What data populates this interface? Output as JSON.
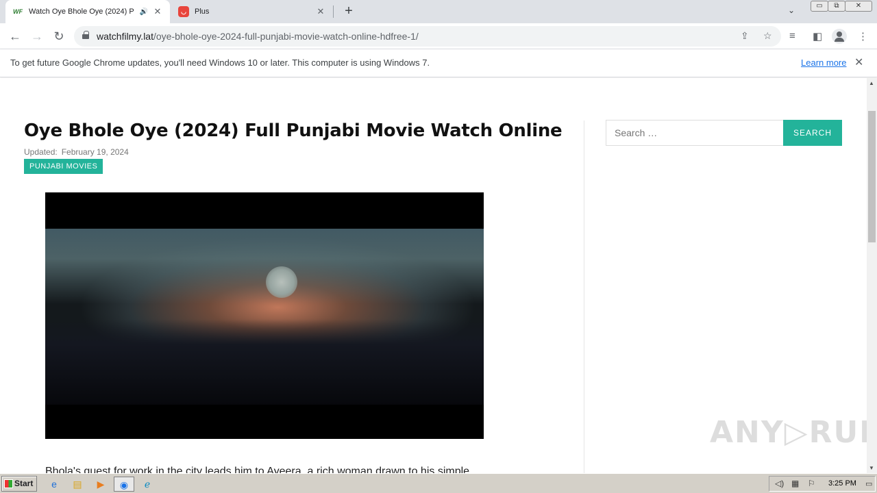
{
  "tabs": [
    {
      "favicon": "WF",
      "title": "Watch Oye Bhole Oye (2024) P",
      "audio_icon": "🔊",
      "close": "✕"
    },
    {
      "favicon": "plus-logo",
      "title": "Plus",
      "close": "✕"
    }
  ],
  "window_controls": {
    "minimize": "▭",
    "restore": "⧉",
    "close": "✕"
  },
  "address_bar": {
    "host": "watchfilmy.lat",
    "path": "/oye-bhole-oye-2024-full-punjabi-movie-watch-online-hdfree-1/"
  },
  "infobar": {
    "message": "To get future Google Chrome updates, you'll need Windows 10 or later. This computer is using Windows 7.",
    "link": "Learn more"
  },
  "page": {
    "title": "Oye Bhole Oye (2024) Full Punjabi Movie Watch Online",
    "updated_label": "Updated:",
    "updated_date": "February 19, 2024",
    "category": "PUNJABI MOVIES",
    "excerpt": "Bhola's quest for work in the city leads him to Ayeera, a rich woman drawn to his simple",
    "search_placeholder": "Search …",
    "search_button": "SEARCH",
    "watermark": "ANY▷RUN"
  },
  "taskbar": {
    "start": "Start",
    "clock": "3:25 PM"
  },
  "colors": {
    "accent": "#23b39a",
    "link": "#1a73e8"
  }
}
